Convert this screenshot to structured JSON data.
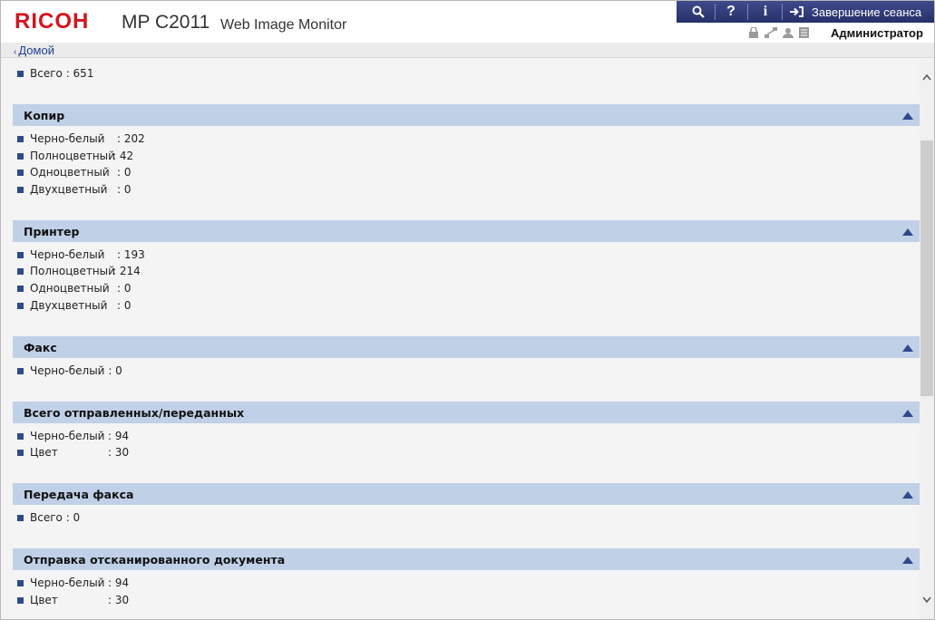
{
  "header": {
    "brand": "RICOH",
    "model": "MP C2011",
    "product": "Web Image Monitor",
    "logout_label": "Завершение сеанса",
    "user_label": "Администратор",
    "icons": [
      "search-icon",
      "help-icon",
      "info-icon",
      "logout-icon",
      "lock-icon",
      "network-icon",
      "user-icon",
      "document-icon"
    ]
  },
  "nav": {
    "home_label": "Домой"
  },
  "top_row": {
    "label": "Всего",
    "value": ": 651"
  },
  "sections": [
    {
      "title": "Копир",
      "rows": [
        {
          "label": "Черно-белый",
          "value": ": 202"
        },
        {
          "label": "Полноцветный",
          "value": ": 42"
        },
        {
          "label": "Одноцветный",
          "value": ": 0"
        },
        {
          "label": "Двухцветный",
          "value": ": 0"
        }
      ]
    },
    {
      "title": "Принтер",
      "rows": [
        {
          "label": "Черно-белый",
          "value": ": 193"
        },
        {
          "label": "Полноцветный",
          "value": ": 214"
        },
        {
          "label": "Одноцветный",
          "value": ": 0"
        },
        {
          "label": "Двухцветный",
          "value": ": 0"
        }
      ]
    },
    {
      "title": "Факс",
      "rows": [
        {
          "label": "Черно-белый",
          "value": ": 0"
        }
      ]
    },
    {
      "title": "Всего отправленных/переданных",
      "rows": [
        {
          "label": "Черно-белый",
          "value": ": 94"
        },
        {
          "label": "Цвет",
          "value": ": 30"
        }
      ]
    },
    {
      "title": "Передача факса",
      "rows": [
        {
          "label": "Всего",
          "value": ": 0"
        }
      ]
    },
    {
      "title": "Отправка отсканированного документа",
      "rows": [
        {
          "label": "Черно-белый",
          "value": ": 94"
        },
        {
          "label": "Цвет",
          "value": ": 30"
        }
      ]
    }
  ],
  "colors": {
    "brand_red": "#d4141d",
    "topbar_blue": "#2f3a78",
    "section_header": "#c0d0e7",
    "bullet": "#2e4a8b",
    "link": "#1f3f91"
  }
}
